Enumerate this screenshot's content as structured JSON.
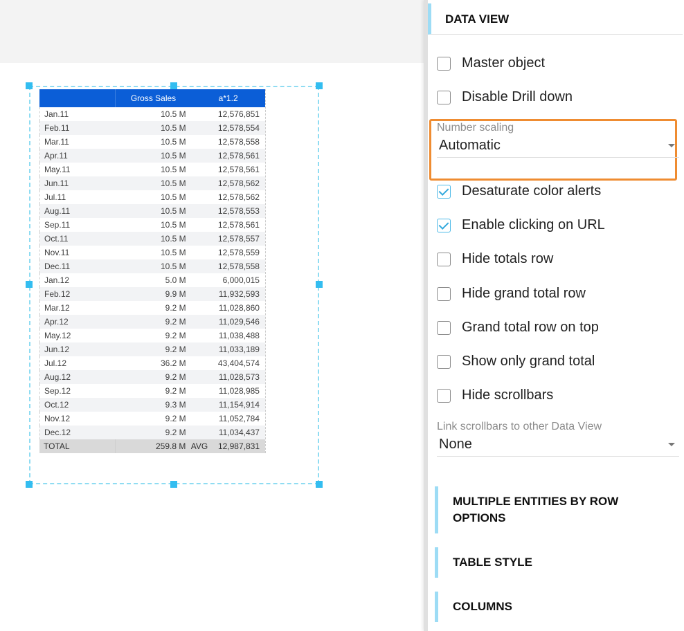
{
  "table": {
    "columns": [
      "",
      "Gross Sales",
      "a*1.2"
    ],
    "rows": [
      {
        "period": "Jan.11",
        "gross_sales": "10.5 M",
        "a12": "12,576,851"
      },
      {
        "period": "Feb.11",
        "gross_sales": "10.5 M",
        "a12": "12,578,554"
      },
      {
        "period": "Mar.11",
        "gross_sales": "10.5 M",
        "a12": "12,578,558"
      },
      {
        "period": "Apr.11",
        "gross_sales": "10.5 M",
        "a12": "12,578,561"
      },
      {
        "period": "May.11",
        "gross_sales": "10.5 M",
        "a12": "12,578,561"
      },
      {
        "period": "Jun.11",
        "gross_sales": "10.5 M",
        "a12": "12,578,562"
      },
      {
        "period": "Jul.11",
        "gross_sales": "10.5 M",
        "a12": "12,578,562"
      },
      {
        "period": "Aug.11",
        "gross_sales": "10.5 M",
        "a12": "12,578,553"
      },
      {
        "period": "Sep.11",
        "gross_sales": "10.5 M",
        "a12": "12,578,561"
      },
      {
        "period": "Oct.11",
        "gross_sales": "10.5 M",
        "a12": "12,578,557"
      },
      {
        "period": "Nov.11",
        "gross_sales": "10.5 M",
        "a12": "12,578,559"
      },
      {
        "period": "Dec.11",
        "gross_sales": "10.5 M",
        "a12": "12,578,558"
      },
      {
        "period": "Jan.12",
        "gross_sales": "5.0 M",
        "a12": "6,000,015"
      },
      {
        "period": "Feb.12",
        "gross_sales": "9.9 M",
        "a12": "11,932,593"
      },
      {
        "period": "Mar.12",
        "gross_sales": "9.2 M",
        "a12": "11,028,860"
      },
      {
        "period": "Apr.12",
        "gross_sales": "9.2 M",
        "a12": "11,029,546"
      },
      {
        "period": "May.12",
        "gross_sales": "9.2 M",
        "a12": "11,038,488"
      },
      {
        "period": "Jun.12",
        "gross_sales": "9.2 M",
        "a12": "11,033,189"
      },
      {
        "period": "Jul.12",
        "gross_sales": "36.2 M",
        "a12": "43,404,574"
      },
      {
        "period": "Aug.12",
        "gross_sales": "9.2 M",
        "a12": "11,028,573"
      },
      {
        "period": "Sep.12",
        "gross_sales": "9.2 M",
        "a12": "11,028,985"
      },
      {
        "period": "Oct.12",
        "gross_sales": "9.3 M",
        "a12": "11,154,914"
      },
      {
        "period": "Nov.12",
        "gross_sales": "9.2 M",
        "a12": "11,052,784"
      },
      {
        "period": "Dec.12",
        "gross_sales": "9.2 M",
        "a12": "11,034,437"
      }
    ],
    "total": {
      "label": "TOTAL",
      "gross_sales": "259.8 M",
      "agg_label": "AVG",
      "a12": "12,987,831"
    }
  },
  "panel": {
    "title": "DATA VIEW",
    "options": [
      {
        "label": "Master object",
        "checked": false
      },
      {
        "label": "Disable Drill down",
        "checked": false
      }
    ],
    "number_scaling": {
      "label": "Number scaling",
      "value": "Automatic"
    },
    "options2": [
      {
        "label": "Desaturate color alerts",
        "checked": true
      },
      {
        "label": "Enable clicking on URL",
        "checked": true
      },
      {
        "label": "Hide totals row",
        "checked": false
      },
      {
        "label": "Hide grand total row",
        "checked": false
      },
      {
        "label": "Grand total row on top",
        "checked": false
      },
      {
        "label": "Show only grand total",
        "checked": false
      },
      {
        "label": "Hide scrollbars",
        "checked": false
      }
    ],
    "link_scrollbars": {
      "label": "Link scrollbars to other Data View",
      "value": "None"
    },
    "sections": [
      {
        "label": "MULTIPLE ENTITIES BY ROW OPTIONS"
      },
      {
        "label": "TABLE STYLE"
      },
      {
        "label": "COLUMNS"
      }
    ]
  },
  "colors": {
    "header_blue": "#0b5ed7",
    "accent_orange": "#ef8c31",
    "accent_cyan": "#33bdf0"
  }
}
